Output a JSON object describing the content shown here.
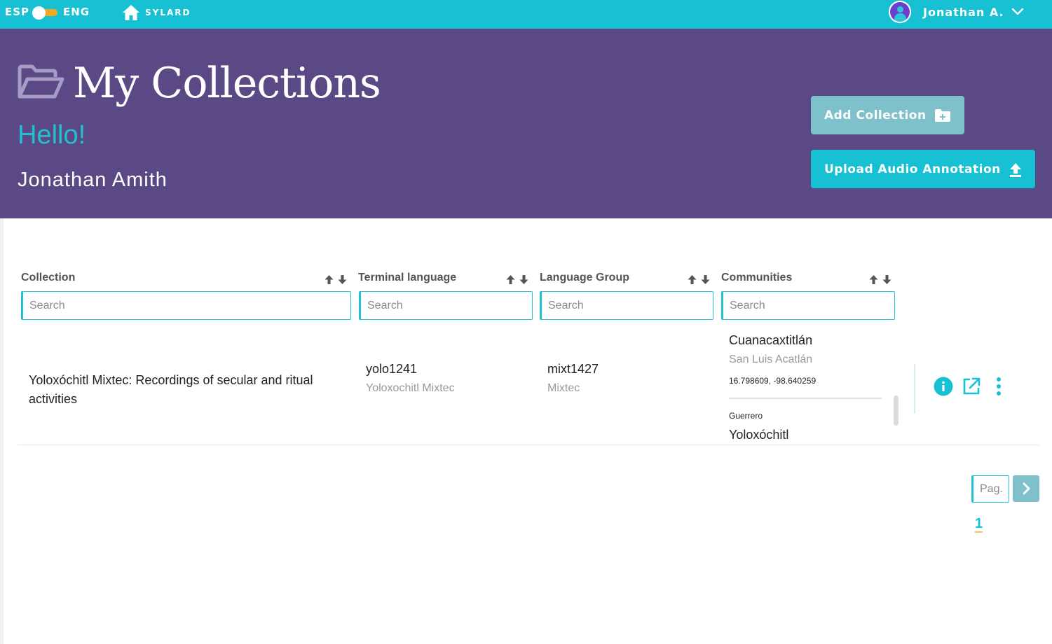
{
  "topbar": {
    "lang_left": "ESP",
    "lang_right": "ENG",
    "brand": "SYLARD",
    "user_name": "Jonathan A.",
    "accent": "#17c1d3",
    "toggle_accent": "#f5a623"
  },
  "header": {
    "title": "My Collections",
    "greeting": "Hello!",
    "full_name": "Jonathan Amith",
    "background": "#5b4985",
    "add_collection_label": "Add Collection",
    "upload_label": "Upload Audio Annotation"
  },
  "table": {
    "columns": [
      {
        "label": "Collection",
        "placeholder": "Search"
      },
      {
        "label": "Terminal language",
        "placeholder": "Search"
      },
      {
        "label": "Language Group",
        "placeholder": "Search"
      },
      {
        "label": "Communities",
        "placeholder": "Search"
      }
    ],
    "rows": [
      {
        "collection": "Yoloxóchitl Mixtec: Recordings of secular and ritual activities",
        "terminal_code": "yolo1241",
        "terminal_name": "Yoloxochitl Mixtec",
        "group_code": "mixt1427",
        "group_name": "Mixtec",
        "communities": [
          {
            "name": "Cuanacaxtitlán",
            "municipality": "San Luis Acatlán",
            "coords": "16.798609, -98.640259",
            "state": "Guerrero"
          },
          {
            "name": "Yoloxóchitl"
          }
        ]
      }
    ]
  },
  "pagination": {
    "placeholder": "Pag.",
    "current_page": "1"
  },
  "icons": [
    "home-icon",
    "folder-open-icon",
    "folder-plus-icon",
    "upload-icon",
    "sort-up-icon",
    "sort-down-icon",
    "info-icon",
    "open-external-icon",
    "more-vertical-icon",
    "chevron-right-icon",
    "chevron-down-icon",
    "user-avatar-icon"
  ]
}
